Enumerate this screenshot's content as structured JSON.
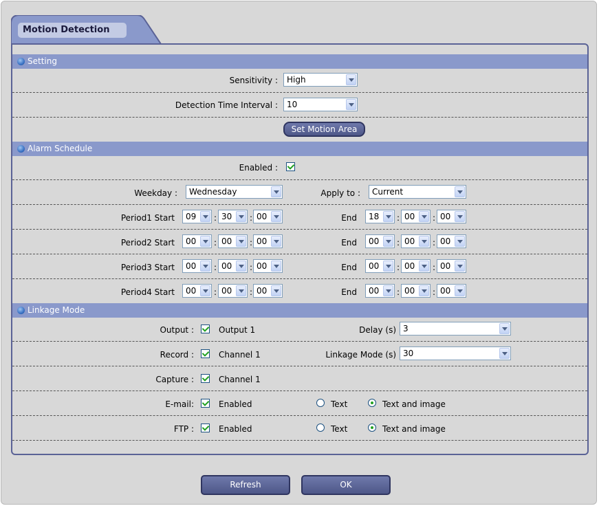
{
  "tab_title": "Motion Detection",
  "sections": {
    "setting": "Setting",
    "alarm": "Alarm Schedule",
    "linkage": "Linkage Mode"
  },
  "setting": {
    "sensitivity_label": "Sensitivity :",
    "sensitivity_value": "High",
    "interval_label": "Detection Time Interval :",
    "interval_value": "10",
    "motion_area_button": "Set Motion Area"
  },
  "alarm": {
    "enabled_label": "Enabled :",
    "weekday_label": "Weekday :",
    "weekday_value": "Wednesday",
    "apply_label": "Apply to :",
    "apply_value": "Current",
    "end_label": "End",
    "periods": [
      {
        "label": "Period1 Start",
        "start": [
          "09",
          "30",
          "00"
        ],
        "end": [
          "18",
          "00",
          "00"
        ]
      },
      {
        "label": "Period2 Start",
        "start": [
          "00",
          "00",
          "00"
        ],
        "end": [
          "00",
          "00",
          "00"
        ]
      },
      {
        "label": "Period3 Start",
        "start": [
          "00",
          "00",
          "00"
        ],
        "end": [
          "00",
          "00",
          "00"
        ]
      },
      {
        "label": "Period4 Start",
        "start": [
          "00",
          "00",
          "00"
        ],
        "end": [
          "00",
          "00",
          "00"
        ]
      }
    ]
  },
  "linkage": {
    "output_label": "Output :",
    "output_value": "Output 1",
    "delay_label": "Delay (s)",
    "delay_value": "3",
    "record_label": "Record :",
    "record_value": "Channel 1",
    "mode_label": "Linkage Mode (s)",
    "mode_value": "30",
    "capture_label": "Capture :",
    "capture_value": "Channel 1",
    "email_label": "E-mail:",
    "email_value": "Enabled",
    "ftp_label": "FTP :",
    "ftp_value": "Enabled",
    "text_option": "Text",
    "text_image_option": "Text and image"
  },
  "buttons": {
    "refresh": "Refresh",
    "ok": "OK"
  }
}
